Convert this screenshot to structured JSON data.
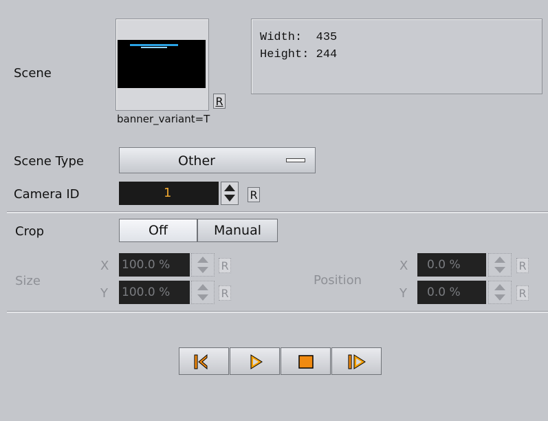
{
  "scene": {
    "label": "Scene",
    "filename": "banner_variant=T",
    "reset_label": "R",
    "info": {
      "width_label": "Width:",
      "width_value": "435",
      "height_label": "Height:",
      "height_value": "244"
    }
  },
  "scene_type": {
    "label": "Scene Type",
    "value": "Other"
  },
  "camera": {
    "label": "Camera ID",
    "value": "1",
    "reset_label": "R"
  },
  "crop": {
    "label": "Crop",
    "options": [
      "Off",
      "Manual"
    ],
    "selected": "Off",
    "size": {
      "label": "Size",
      "x_axis": "X",
      "y_axis": "Y",
      "x_value": "100.0 %",
      "y_value": "100.0 %"
    },
    "position": {
      "label": "Position",
      "x_axis": "X",
      "y_axis": "Y",
      "x_value": "0.0 %",
      "y_value": "0.0 %"
    },
    "reset_label": "R"
  },
  "transport": {
    "buttons": [
      "skip-to-start",
      "play",
      "stop",
      "step-forward"
    ]
  },
  "colors": {
    "background": "#c4c6cb",
    "accent": "#f0a830",
    "field_bg": "#1a1a1a"
  }
}
